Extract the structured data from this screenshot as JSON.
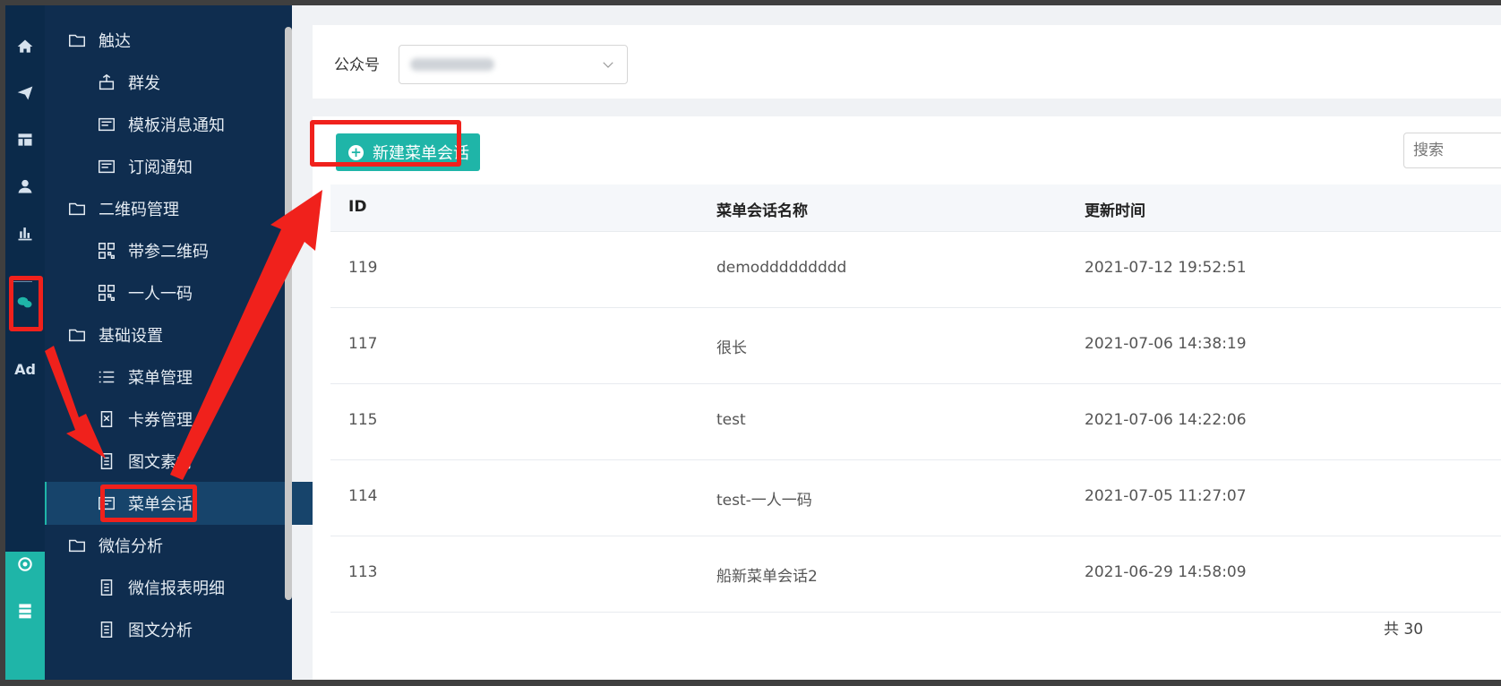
{
  "sidebar": {
    "items": [
      {
        "label": "触达",
        "icon": "folder-icon",
        "level": "group"
      },
      {
        "label": "群发",
        "icon": "broadcast-icon",
        "level": "sub"
      },
      {
        "label": "模板消息通知",
        "icon": "template-icon",
        "level": "sub"
      },
      {
        "label": "订阅通知",
        "icon": "template-icon",
        "level": "sub"
      },
      {
        "label": "二维码管理",
        "icon": "folder-icon",
        "level": "group"
      },
      {
        "label": "带参二维码",
        "icon": "qrcode-icon",
        "level": "sub"
      },
      {
        "label": "一人一码",
        "icon": "qrcode-icon",
        "level": "sub"
      },
      {
        "label": "基础设置",
        "icon": "folder-icon",
        "level": "group"
      },
      {
        "label": "菜单管理",
        "icon": "list-icon",
        "level": "sub"
      },
      {
        "label": "卡券管理",
        "icon": "coupon-icon",
        "level": "sub"
      },
      {
        "label": "图文素材",
        "icon": "document-icon",
        "level": "sub"
      },
      {
        "label": "菜单会话",
        "icon": "template-icon",
        "level": "sub",
        "active": true
      },
      {
        "label": "微信分析",
        "icon": "folder-icon",
        "level": "group"
      },
      {
        "label": "微信报表明细",
        "icon": "document-icon",
        "level": "sub"
      },
      {
        "label": "图文分析",
        "icon": "document-icon",
        "level": "sub"
      }
    ]
  },
  "rail": {
    "icons": [
      "home-icon",
      "send-icon",
      "layout-icon",
      "user-icon",
      "bar-chart-icon",
      "wechat-icon",
      "target-icon",
      "server-icon"
    ],
    "ad_label": "Ad"
  },
  "filter": {
    "account_label": "公众号"
  },
  "toolbar": {
    "new_button_label": "新建菜单会话",
    "search_placeholder": "搜索"
  },
  "table": {
    "columns": [
      "ID",
      "菜单会话名称",
      "更新时间"
    ],
    "rows": [
      {
        "id": "119",
        "name": "demoddddddddd",
        "updated": "2021-07-12 19:52:51"
      },
      {
        "id": "117",
        "name": "很长",
        "updated": "2021-07-06 14:38:19"
      },
      {
        "id": "115",
        "name": "test",
        "updated": "2021-07-06 14:22:06"
      },
      {
        "id": "114",
        "name": "test-一人一码",
        "updated": "2021-07-05 11:27:07"
      },
      {
        "id": "113",
        "name": "船新菜单会话2",
        "updated": "2021-06-29 14:58:09"
      }
    ]
  },
  "pagination": {
    "total_text": "共 30"
  },
  "colors": {
    "accent": "#1fb5a8",
    "sidebar_bg": "#0f2d4f",
    "annotation_red": "#f0211c"
  }
}
